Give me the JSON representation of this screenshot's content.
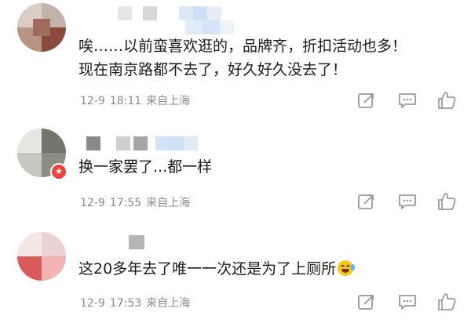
{
  "colors": {
    "text": "#1a1a1a",
    "meta": "#8a8a8a",
    "icon": "#9a9a9a",
    "badge": "#e8453c"
  },
  "comments": [
    {
      "text_lines": [
        "唉……以前蛮喜欢逛的，品牌齐，折扣活动也多！",
        "现在南京路都不去了，好久好久没去了！"
      ],
      "date": "12-9",
      "time": "18:11",
      "location": "来自上海",
      "actions": [
        "share-icon",
        "comment-icon",
        "like-icon"
      ]
    },
    {
      "text_lines": [
        "换一家罢了...都一样"
      ],
      "date": "12-9",
      "time": "17:55",
      "location": "来自上海",
      "badge_icon": "vip-badge-icon",
      "actions": [
        "share-icon",
        "comment-icon",
        "like-icon"
      ]
    },
    {
      "text_lines": [
        "这20多年去了唯一一次还是为了上厕所"
      ],
      "trailing_emoji": "laugh-cry-emoji-icon",
      "date": "12-9",
      "time": "17:53",
      "location": "来自上海",
      "actions": [
        "share-icon",
        "comment-icon",
        "like-icon"
      ]
    }
  ]
}
